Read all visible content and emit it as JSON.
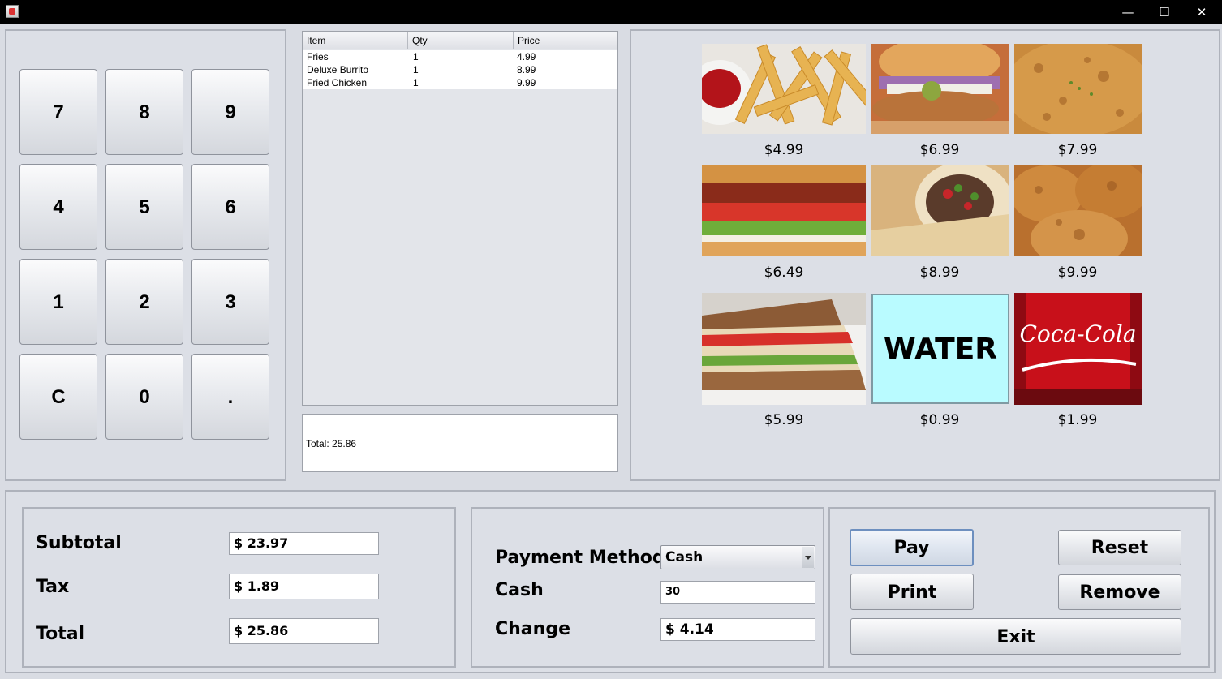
{
  "window": {
    "controls": {
      "minimize": "—",
      "maximize": "☐",
      "close": "✕"
    }
  },
  "keypad": {
    "keys": [
      "7",
      "8",
      "9",
      "4",
      "5",
      "6",
      "1",
      "2",
      "3",
      "C",
      "0",
      "."
    ]
  },
  "order_table": {
    "columns": [
      "Item",
      "Qty",
      "Price"
    ],
    "rows": [
      {
        "item": "Fries",
        "qty": "1",
        "price": "4.99"
      },
      {
        "item": "Deluxe Burrito",
        "qty": "1",
        "price": "8.99"
      },
      {
        "item": "Fried Chicken",
        "qty": "1",
        "price": "9.99"
      }
    ],
    "total_text": "Total: 25.86"
  },
  "menu": {
    "items": [
      {
        "name": "fries",
        "price": "$4.99",
        "icon": "fries-image"
      },
      {
        "name": "chicken-sandwich",
        "price": "$6.99",
        "icon": "chicken-sandwich-image"
      },
      {
        "name": "schnitzel",
        "price": "$7.99",
        "icon": "schnitzel-image"
      },
      {
        "name": "blt-sandwich",
        "price": "$6.49",
        "icon": "blt-image"
      },
      {
        "name": "burrito",
        "price": "$8.99",
        "icon": "burrito-image"
      },
      {
        "name": "fried-chicken",
        "price": "$9.99",
        "icon": "fried-chicken-image"
      },
      {
        "name": "tuna-sandwich",
        "price": "$5.99",
        "icon": "tuna-sandwich-image"
      },
      {
        "name": "water",
        "price": "$0.99",
        "label": "WATER",
        "color": "#b9fbff"
      },
      {
        "name": "coca-cola",
        "price": "$1.99",
        "label": "Coca-Cola",
        "color": "#c8101a"
      }
    ]
  },
  "totals": {
    "subtotal_label": "Subtotal",
    "subtotal_value": "$ 23.97",
    "tax_label": "Tax",
    "tax_value": "$ 1.89",
    "total_label": "Total",
    "total_value": "$ 25.86"
  },
  "payment": {
    "method_label": "Payment Method",
    "method_value": "Cash",
    "cash_label": "Cash",
    "cash_value": "30",
    "change_label": "Change",
    "change_value": "$ 4.14"
  },
  "actions": {
    "pay": "Pay",
    "reset": "Reset",
    "print": "Print",
    "remove": "Remove",
    "exit": "Exit"
  }
}
